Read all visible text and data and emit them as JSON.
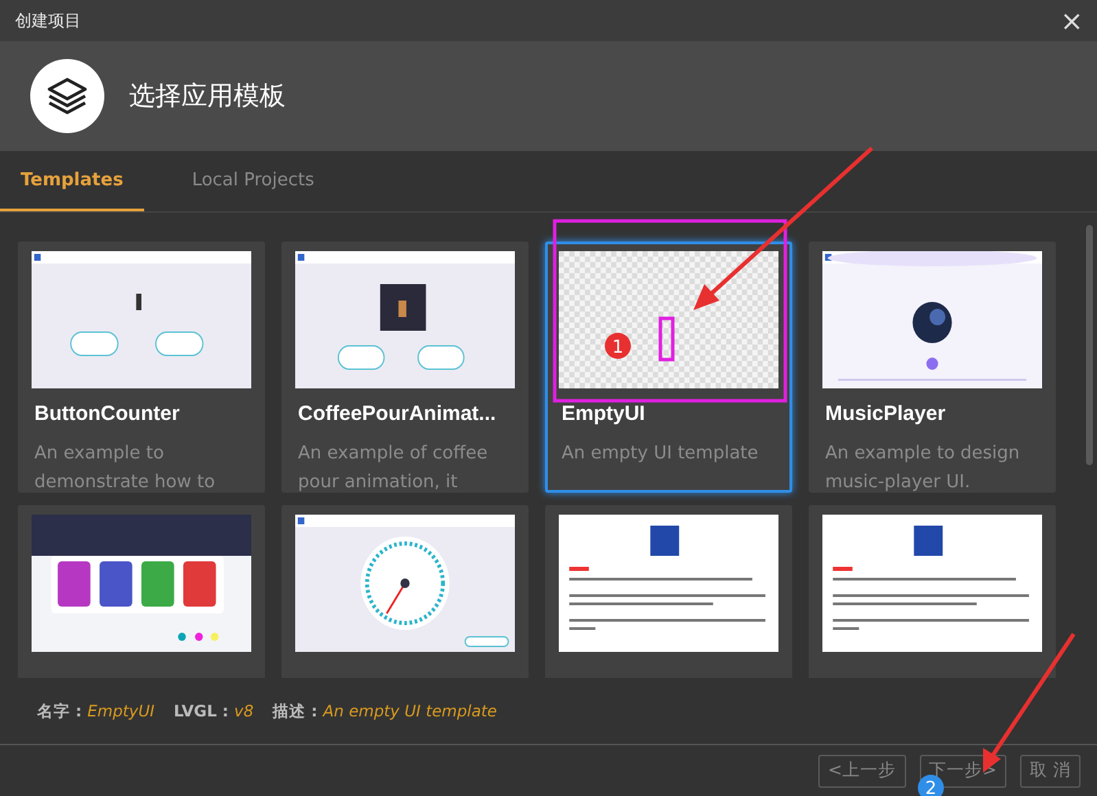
{
  "window": {
    "title": "创建项目",
    "close": "×"
  },
  "header": {
    "title": "选择应用模板"
  },
  "tabs": [
    {
      "label": "Templates",
      "selected": true
    },
    {
      "label": "Local Projects",
      "selected": false
    }
  ],
  "templates": [
    {
      "name": "ButtonCounter",
      "description": "An example to demonstrate how to",
      "selected": false,
      "kind": "counter"
    },
    {
      "name": "CoffeePourAnimat...",
      "description": "An example of coffee pour animation, it",
      "selected": false,
      "kind": "coffee"
    },
    {
      "name": "EmptyUI",
      "description": "An empty UI template",
      "selected": true,
      "kind": "empty"
    },
    {
      "name": "MusicPlayer",
      "description": "An example to design music-player UI.",
      "selected": false,
      "kind": "music"
    },
    {
      "selected": false,
      "kind": "printer"
    },
    {
      "selected": false,
      "kind": "gauge"
    },
    {
      "selected": false,
      "kind": "tips"
    },
    {
      "selected": false,
      "kind": "tips2"
    }
  ],
  "info": [
    {
      "label": "名字 :",
      "value": "EmptyUI"
    },
    {
      "label": "LVGL :",
      "value": "v8"
    },
    {
      "label": "描述 :",
      "value": "An empty UI template"
    }
  ],
  "buttons": [
    {
      "label": "<上一步"
    },
    {
      "label": "下一步>"
    },
    {
      "label": "取 消"
    }
  ],
  "annotations": [
    {
      "kind": "badge",
      "label": "1"
    },
    {
      "kind": "badge",
      "label": "2"
    }
  ]
}
